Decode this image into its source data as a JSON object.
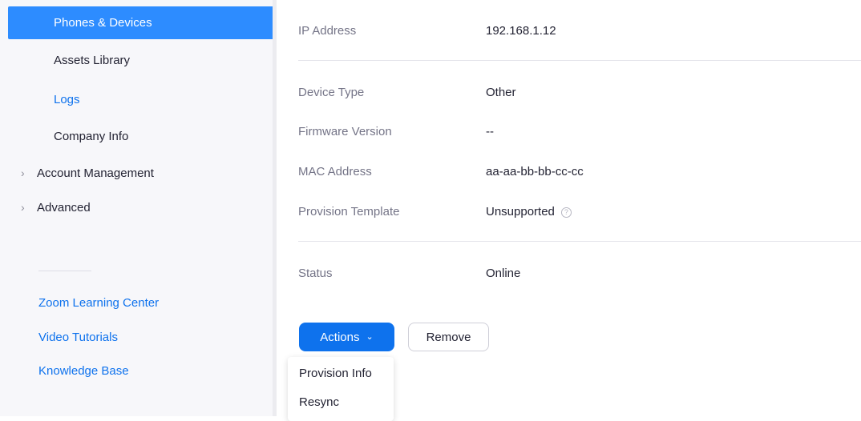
{
  "sidebar": {
    "items": [
      {
        "label": "Phones & Devices",
        "active": true
      },
      {
        "label": "Assets Library"
      },
      {
        "label": "Logs"
      },
      {
        "label": "Company Info"
      }
    ],
    "groups": [
      {
        "label": "Account Management"
      },
      {
        "label": "Advanced"
      }
    ],
    "help_links": [
      {
        "label": "Zoom Learning Center"
      },
      {
        "label": "Video Tutorials"
      },
      {
        "label": "Knowledge Base"
      }
    ]
  },
  "details": {
    "ip": {
      "label": "IP Address",
      "value": "192.168.1.12"
    },
    "device_type": {
      "label": "Device Type",
      "value": "Other"
    },
    "firmware": {
      "label": "Firmware Version",
      "value": "--"
    },
    "mac": {
      "label": "MAC Address",
      "value": "aa-aa-bb-bb-cc-cc"
    },
    "template": {
      "label": "Provision Template",
      "value": "Unsupported"
    },
    "status": {
      "label": "Status",
      "value": "Online"
    }
  },
  "actions": {
    "primary_label": "Actions",
    "secondary_label": "Remove",
    "menu": [
      "Provision Info",
      "Resync"
    ]
  },
  "colors": {
    "accent": "#2d8cff",
    "primary_button": "#0e72ed",
    "link": "#0e72ed"
  }
}
